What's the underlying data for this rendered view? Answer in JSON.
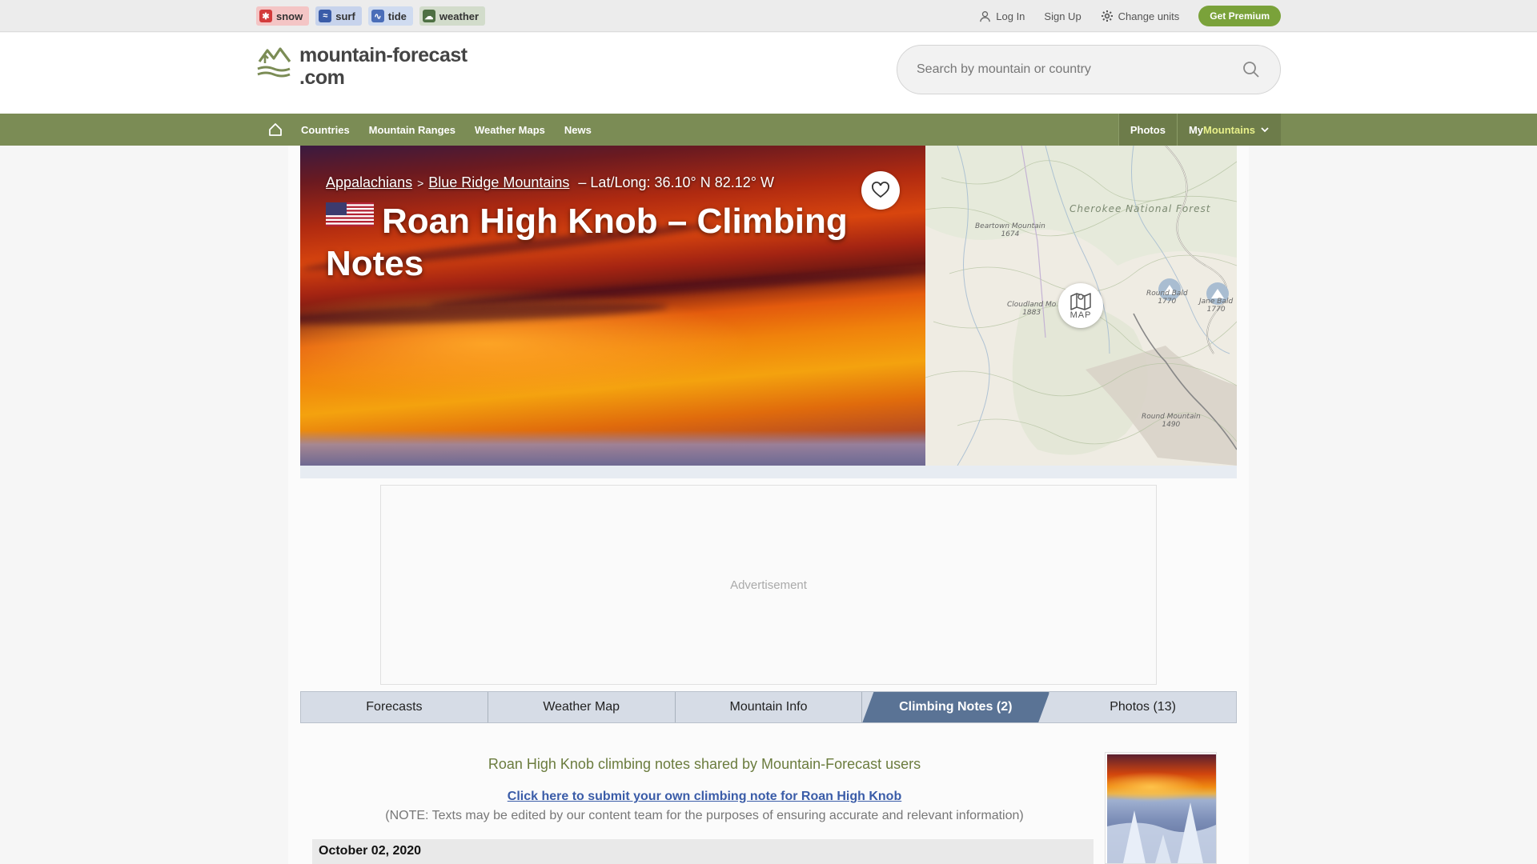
{
  "family_sites": [
    {
      "label": "snow",
      "icon": "snowflake-icon"
    },
    {
      "label": "surf",
      "icon": "wave-icon"
    },
    {
      "label": "tide",
      "icon": "tide-icon"
    },
    {
      "label": "weather",
      "icon": "cloud-icon"
    }
  ],
  "account": {
    "login": "Log In",
    "signup": "Sign Up",
    "units": "Change units",
    "premium": "Get Premium"
  },
  "logo": {
    "line1": "mountain-forecast",
    "line2": ".com"
  },
  "search": {
    "placeholder": "Search by mountain or country"
  },
  "nav": {
    "items": [
      "Countries",
      "Mountain Ranges",
      "Weather Maps",
      "News"
    ],
    "photos": "Photos",
    "my_prefix": "My",
    "my_accent": "Mountains"
  },
  "hero": {
    "crumb1": "Appalachians",
    "crumb_sep": ">",
    "crumb2": "Blue Ridge Mountains",
    "latlong": "– Lat/Long: 36.10° N 82.12° W",
    "title": "Roan High Knob – Climbing Notes"
  },
  "map": {
    "button": "MAP",
    "forest": "Cherokee National Forest",
    "labels": [
      {
        "name": "Beartown Mountain",
        "elev": "1674"
      },
      {
        "name": "Cloudland Mo",
        "elev": "1883"
      },
      {
        "name": "Round Bald",
        "elev": "1770"
      },
      {
        "name": "Jane Bald",
        "elev": "1770"
      },
      {
        "name": "Round Mountain",
        "elev": "1490"
      }
    ]
  },
  "ad": {
    "label": "Advertisement"
  },
  "tabs": [
    {
      "label": "Forecasts",
      "active": false
    },
    {
      "label": "Weather Map",
      "active": false
    },
    {
      "label": "Mountain Info",
      "active": false
    },
    {
      "label": "Climbing Notes (2)",
      "active": true
    },
    {
      "label": "Photos (13)",
      "active": false
    }
  ],
  "notes": {
    "heading": "Roan High Knob climbing notes shared by Mountain-Forecast users",
    "submit": "Click here to submit your own climbing note for Roan High Knob",
    "disclaimer": "(NOTE: Texts may be edited by our content team for the purposes of ensuring accurate and relevant information)",
    "entries": [
      {
        "date": "October 02, 2020"
      }
    ]
  },
  "colors": {
    "nav_green": "#7b8c55",
    "premium_green": "#7aa23a",
    "tab_active": "#5a7395",
    "heading_green": "#6b7c3e",
    "link_blue": "#3a5ca8"
  }
}
